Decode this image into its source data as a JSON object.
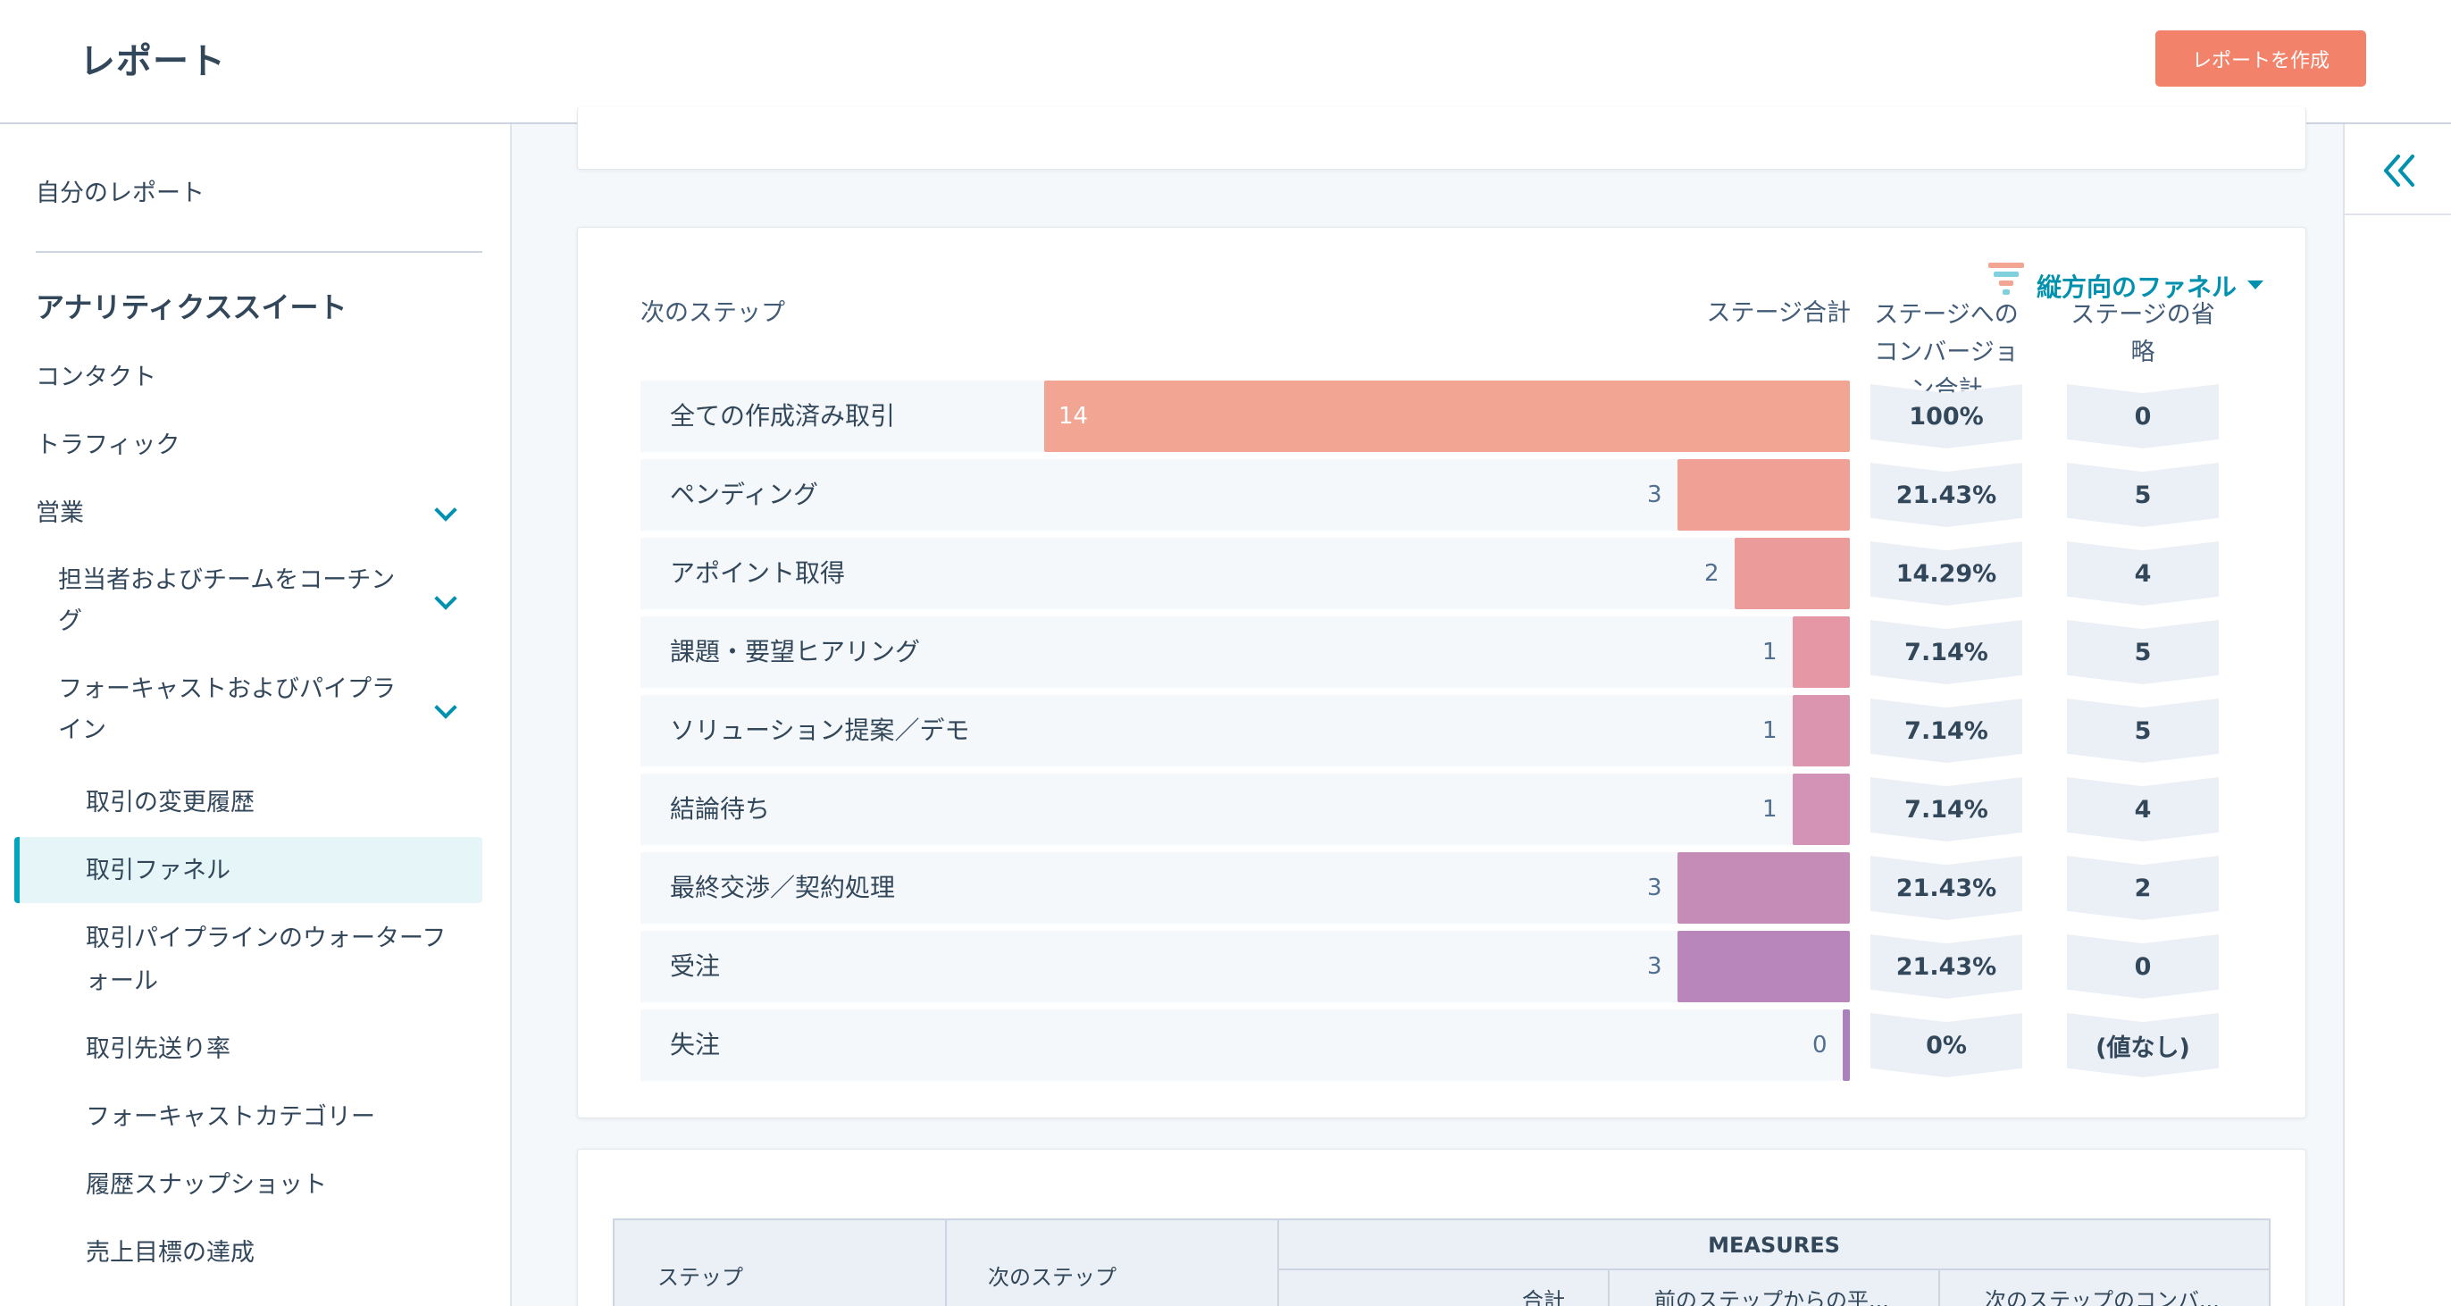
{
  "header": {
    "title": "レポート",
    "create_button": "レポートを作成"
  },
  "sidebar": {
    "my_reports": "自分のレポート",
    "suite_heading": "アナリティクススイート",
    "items": {
      "contacts": "コンタクト",
      "traffic": "トラフィック",
      "sales": "営業",
      "coaching_line1": "担当者およびチームをコーチン",
      "coaching_line2": "グ",
      "forecast_line1": "フォーキャストおよびパイプラ",
      "forecast_line2": "イン",
      "deal_change_history": "取引の変更履歴",
      "deal_funnel": "取引ファネル",
      "waterfall_line1": "取引パイプラインのウォーターフ",
      "waterfall_line2": "ォール",
      "deal_push_rate": "取引先送り率",
      "forecast_category": "フォーキャストカテゴリー",
      "history_snapshot": "履歴スナップショット",
      "sales_goal": "売上目標の達成"
    }
  },
  "funnel": {
    "view_selector": "縦方向のファネル",
    "columns": {
      "next_step": "次のステップ",
      "stage_total": "ステージ合計",
      "conversion_line1": "ステージへの",
      "conversion_line2": "コンバージョ",
      "conversion_line3": "ン合計",
      "skipped_line1": "ステージの省",
      "skipped_line2": "略"
    },
    "colors": [
      "#f2a593",
      "#f0a095",
      "#ec9b9b",
      "#e597a6",
      "#dc95ae",
      "#d393b6",
      "#c58cb8",
      "#b886bb",
      "#ab81bd"
    ]
  },
  "chart_data": {
    "type": "bar",
    "categories": [
      "全ての作成済み取引",
      "ペンディング",
      "アポイント取得",
      "課題・要望ヒアリング",
      "ソリューション提案／デモ",
      "結論待ち",
      "最終交渉／契約処理",
      "受注",
      "失注"
    ],
    "values": [
      14,
      3,
      2,
      1,
      1,
      1,
      3,
      3,
      0
    ],
    "conversion": [
      "100%",
      "21.43%",
      "14.29%",
      "7.14%",
      "7.14%",
      "7.14%",
      "21.43%",
      "21.43%",
      "0%"
    ],
    "skipped": [
      "0",
      "5",
      "4",
      "5",
      "5",
      "4",
      "2",
      "0",
      "(値なし)"
    ],
    "xlim": [
      0,
      14
    ]
  },
  "table": {
    "step": "ステップ",
    "next_step": "次のステップ",
    "measures": "MEASURES",
    "total": "合計",
    "avg_from_prev": "前のステップからの平...",
    "conv_to_next": "次のステップのコンバ..."
  }
}
